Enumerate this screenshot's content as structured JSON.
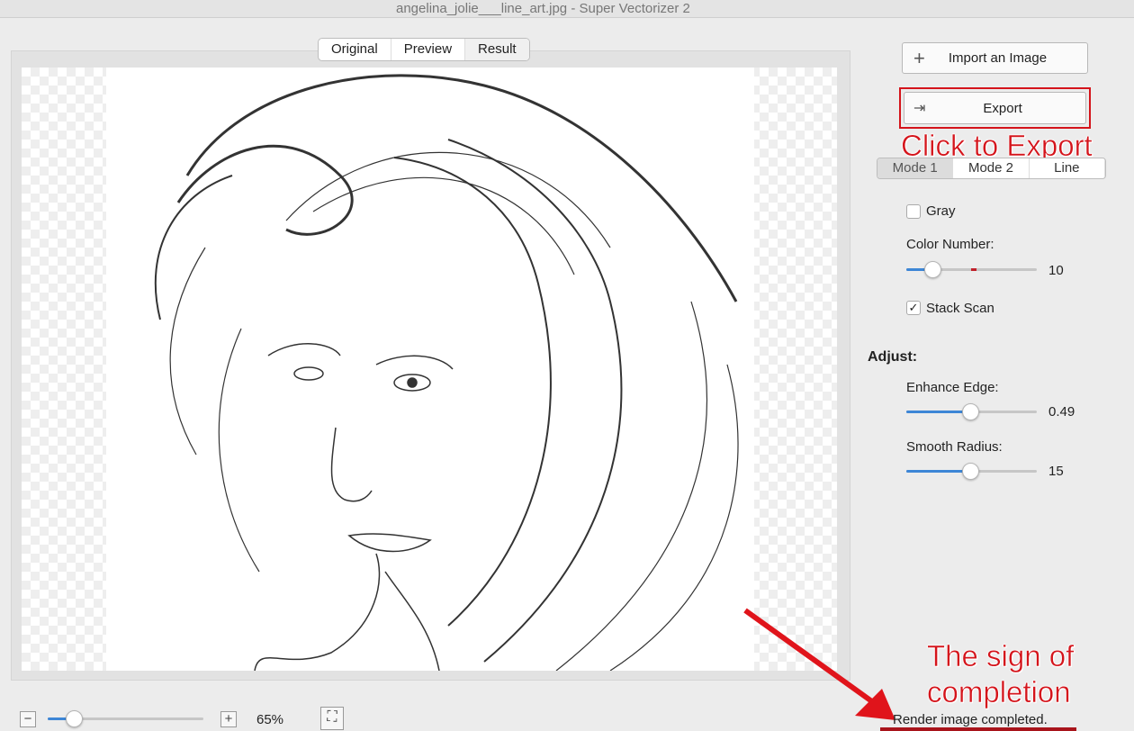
{
  "window": {
    "title": "angelina_jolie___line_art.jpg - Super Vectorizer 2"
  },
  "view_tabs": [
    "Original",
    "Preview",
    "Result"
  ],
  "sidebar": {
    "import_label": "Import an Image",
    "export_label": "Export",
    "modes": [
      "Mode 1",
      "Mode 2",
      "Line"
    ],
    "gray_label": "Gray",
    "gray_checked": false,
    "color_number_label": "Color Number:",
    "color_number_value": "10",
    "color_number_fraction": 0.2,
    "stack_scan_label": "Stack Scan",
    "stack_scan_checked": true,
    "adjust_label": "Adjust:",
    "enhance_edge_label": "Enhance Edge:",
    "enhance_edge_value": "0.49",
    "enhance_edge_fraction": 0.49,
    "smooth_radius_label": "Smooth Radius:",
    "smooth_radius_value": "15",
    "smooth_radius_fraction": 0.49
  },
  "annotations": {
    "export_hint": "Click to Export",
    "completion_line1": "The sign of",
    "completion_line2": "completion"
  },
  "bottom": {
    "zoom_value": "65%",
    "zoom_fraction": 0.17,
    "status": "Render image completed."
  },
  "colors": {
    "accent": "#3d86d6",
    "annotation": "#d4141b"
  }
}
